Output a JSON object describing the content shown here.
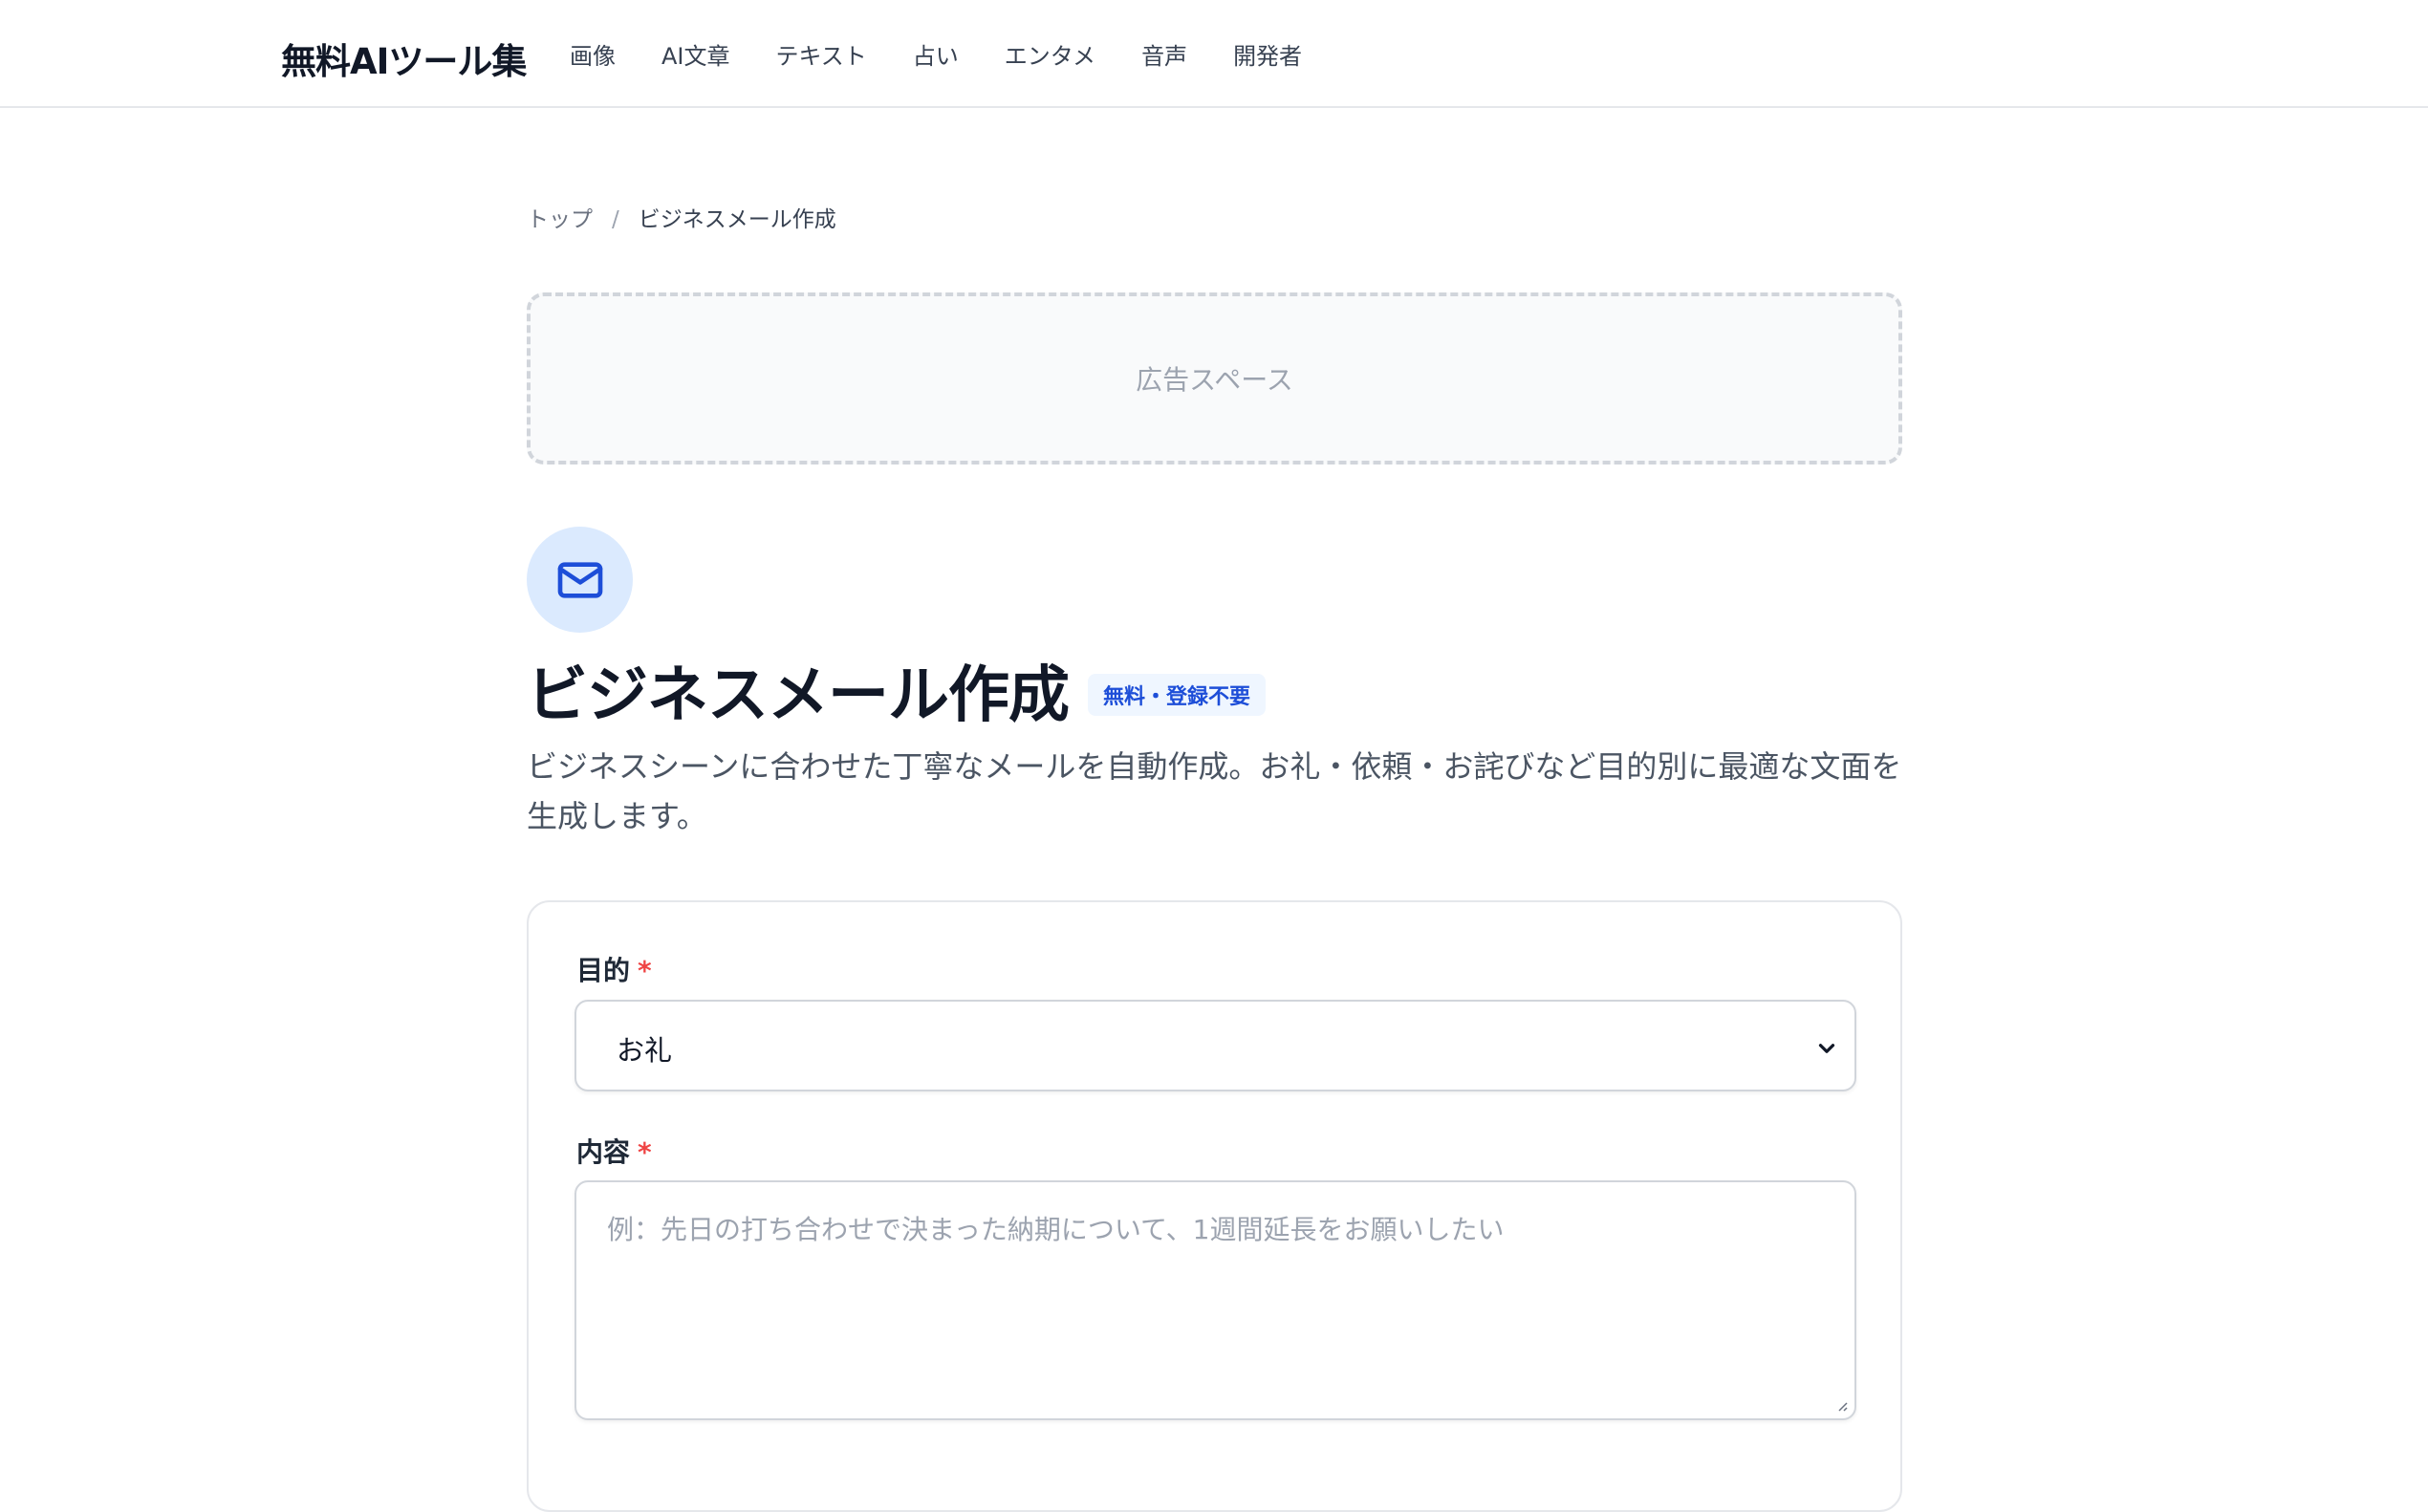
{
  "header": {
    "brand": "無料AIツール集",
    "nav": [
      "画像",
      "AI文章",
      "テキスト",
      "占い",
      "エンタメ",
      "音声",
      "開発者"
    ]
  },
  "breadcrumb": {
    "home": "トップ",
    "separator": "/",
    "current": "ビジネスメール作成"
  },
  "ad": {
    "label": "広告スペース"
  },
  "tool": {
    "icon": "mail-icon",
    "title": "ビジネスメール作成",
    "badge": "無料・登録不要",
    "description": "ビジネスシーンに合わせた丁寧なメールを自動作成。お礼・依頼・お詫びなど目的別に最適な文面を生成します。"
  },
  "form": {
    "purpose": {
      "label": "目的",
      "required_mark": "*",
      "selected": "お礼"
    },
    "content": {
      "label": "内容",
      "required_mark": "*",
      "placeholder": "例：先日の打ち合わせで決まった納期について、1週間延長をお願いしたい",
      "value": ""
    }
  },
  "colors": {
    "accent": "#1d4ed8",
    "icon_bg": "#dbeafe",
    "required": "#ef4444"
  }
}
